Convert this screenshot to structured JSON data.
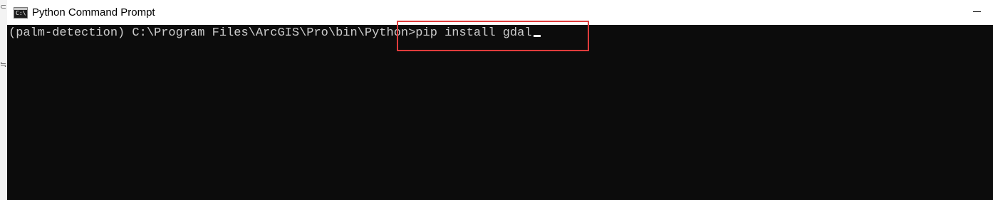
{
  "window": {
    "title": "Python Command Prompt",
    "icon": "cmd-icon",
    "icon_glyph": "C:\\"
  },
  "console": {
    "prompt": "(palm-detection) C:\\Program Files\\ArcGIS\\Pro\\bin\\Python>",
    "command": "pip install gdal",
    "background_color": "#0c0c0c",
    "text_color": "#cccccc"
  },
  "annotation": {
    "highlight_color": "#e03c3c"
  },
  "controls": {
    "minimize_icon": "minimize-icon"
  }
}
